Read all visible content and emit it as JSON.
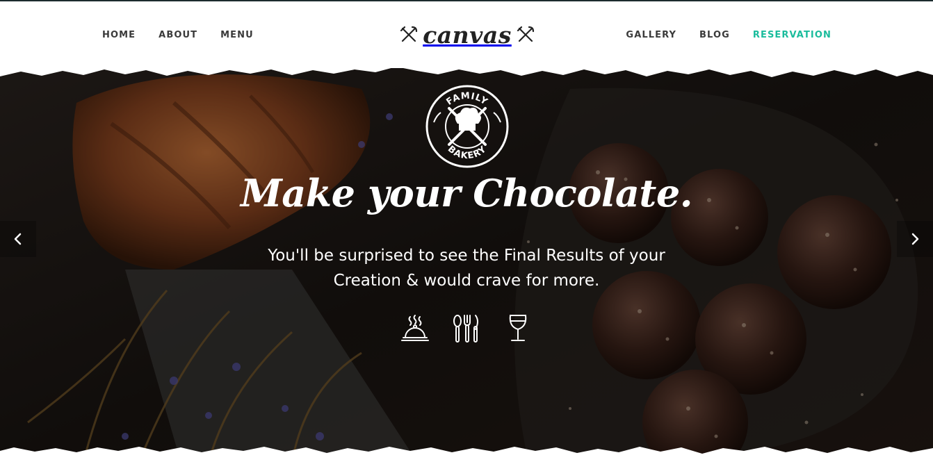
{
  "nav": {
    "left": [
      {
        "label": "HOME",
        "name": "nav-home"
      },
      {
        "label": "ABOUT",
        "name": "nav-about"
      },
      {
        "label": "MENU",
        "name": "nav-menu"
      }
    ],
    "right": [
      {
        "label": "GALLERY",
        "name": "nav-gallery"
      },
      {
        "label": "BLOG",
        "name": "nav-blog"
      },
      {
        "label": "RESERVATION",
        "name": "nav-reservation"
      }
    ],
    "active": "RESERVATION",
    "accent": "#1abc9c"
  },
  "logo": {
    "text": "canvas",
    "icons": [
      "cutlery-cross-icon",
      "cutlery-cross-icon"
    ]
  },
  "hero": {
    "badge": {
      "top_text": "FAMILY",
      "bottom_text": "BAKERY"
    },
    "headline": "Make your Chocolate.",
    "subtitle_line1": "You'll be surprised to see the Final Results of your",
    "subtitle_line2": "Creation & would crave for more.",
    "icons": [
      "cloche-icon",
      "cutlery-icon",
      "wine-glass-icon"
    ]
  },
  "slider": {
    "prev_icon": "chevron-left-icon",
    "next_icon": "chevron-right-icon"
  }
}
